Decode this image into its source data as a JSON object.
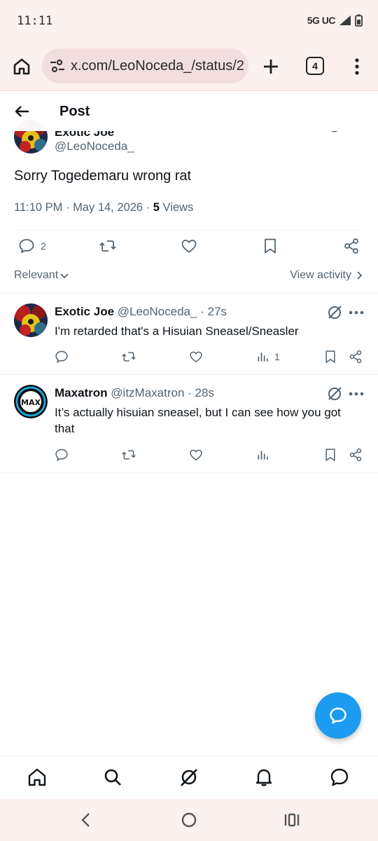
{
  "status_bar": {
    "time": "11:11",
    "network": "5G UC"
  },
  "browser": {
    "url": "x.com/LeoNoceda_/status/2",
    "tab_count": "4"
  },
  "header": {
    "title": "Post"
  },
  "post": {
    "author_name_partial": "Exotic Joe",
    "author_handle": "@LeoNoceda_",
    "text": "Sorry Togedemaru wrong rat",
    "timestamp": "11:10 PM · May 14, 2026 · ",
    "views_count": "5",
    "views_label": " Views",
    "reply_count": "2"
  },
  "sort": {
    "label": "Relevant",
    "view_activity": "View activity"
  },
  "replies": [
    {
      "name": "Exotic Joe",
      "handle_time": " @LeoNoceda_ · 27s",
      "text": "I'm retarded that's a Hisuian Sneasel/Sneasler",
      "views": "1"
    },
    {
      "name": "Maxatron",
      "handle_time": " @itzMaxatron · 28s",
      "text": "It’s actually hisuian sneasel, but I can see how you got that",
      "views": "",
      "avatar_text": "MAX"
    }
  ],
  "colors": {
    "accent": "#1d9bf0",
    "secondary_text": "#536471",
    "chrome_bg": "#fdf1f0"
  },
  "icons": [
    "home-icon",
    "tune-icon",
    "plus-icon",
    "tabs-icon",
    "more-vert-icon",
    "back-arrow-icon",
    "grok-icon",
    "reply-icon",
    "retweet-icon",
    "like-icon",
    "bookmark-icon",
    "share-icon",
    "views-icon",
    "search-icon",
    "bell-icon",
    "messages-icon"
  ]
}
